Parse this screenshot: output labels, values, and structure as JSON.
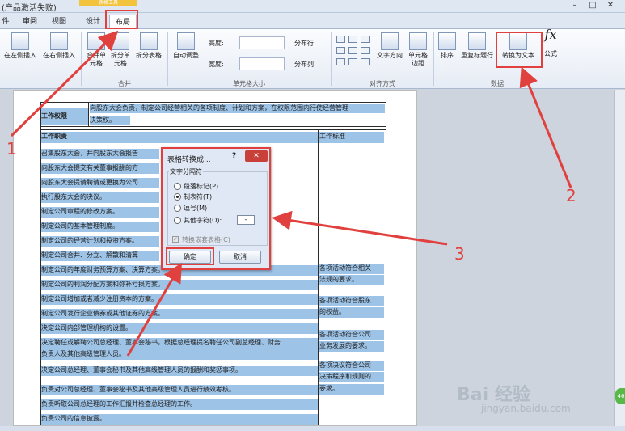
{
  "window": {
    "title": "(产品激活失败)",
    "context_tab_header": "表格工具",
    "min": "–",
    "restore": "□",
    "close": "✕"
  },
  "tabs": [
    {
      "label": "件"
    },
    {
      "label": "审阅"
    },
    {
      "label": "视图"
    },
    {
      "label": "设计"
    },
    {
      "label": "布局",
      "active": true
    }
  ],
  "ribbon": {
    "buttons": {
      "insert_left": "在左侧插入",
      "insert_right": "在右侧插入",
      "merge_cells": "合并单元格",
      "split_cells": "拆分单元格",
      "split_table": "拆分表格",
      "autofit": "自动调整",
      "text_direction": "文字方向",
      "cell_margins": "单元格边距",
      "sort": "排序",
      "repeat_header": "重复标题行",
      "convert_to_text": "转换为文本",
      "formula": "公式"
    },
    "height_label": "高度:",
    "width_label": "宽度:",
    "distribute_rows": "分布行",
    "distribute_cols": "分布列",
    "groups": {
      "merge": "合并",
      "cell_size": "单元格大小",
      "alignment": "对齐方式",
      "data": "数据"
    }
  },
  "table": {
    "header_row": "工作权限",
    "header_text": "向股东大会负责，制定公司经营相关的各项制度、计划和方案，在权限范围内行使经营管理",
    "header_text2": "决策权。",
    "col_duty": "工作职责",
    "col_standard": "工作标准",
    "rows": [
      "召集股东大会，并向股东大会报告",
      "向股东大会提交有关董事报酬的方",
      "向股东大会提请聘请或更换为公司",
      "执行股东大会的决议。",
      "制定公司章程的修改方案。",
      "制定公司的基本管理制度。",
      "制定公司的经营计划和投资方案。",
      "制定公司合并、分立、解散和清算",
      "制定公司的年度财务预算方案、决算方案。",
      "制定公司的利润分配方案和弥补亏损方案。",
      "制定公司增加或者减少注册资本的方案。",
      "制定公司发行企业债券或其他证券的方案。",
      "决定公司内部管理机构的设置。",
      "决定聘任或解聘公司总经理、董事会秘书，根据总经理提名聘任公司副总经理、财务",
      "负责人及其他高级管理人员。",
      "决定公司总经理、董事会秘书及其他高级管理人员的报酬和奖惩事项。",
      "负责对公司总经理、董事会秘书及其他高级管理人员进行绩效考核。",
      "负责听取公司总经理的工作汇报并检查总经理的工作。",
      "负责公司的信息披露。"
    ],
    "standards": [
      "各项活动符合相关",
      "法规的要求。",
      "各项活动符合股东",
      "的权益。",
      "各项活动符合公司",
      "业务发展的要求。",
      "各项决议符合公司",
      "决策程序和规则的",
      "要求。"
    ]
  },
  "dialog": {
    "title": "表格转换成...",
    "help": "?",
    "close": "✕",
    "group_label": "文字分隔符",
    "options": [
      {
        "label": "段落标记(P)",
        "checked": false
      },
      {
        "label": "制表符(T)",
        "checked": true
      },
      {
        "label": "逗号(M)",
        "checked": false
      },
      {
        "label": "其他字符(O):",
        "checked": false
      }
    ],
    "other_char_value": "-",
    "nested_label": "转换嵌套表格(C)",
    "ok": "确定",
    "cancel": "取消"
  },
  "annotations": {
    "num1": "1",
    "num2": "2",
    "num3": "3"
  },
  "watermark": {
    "text": "Bai 经验",
    "sub": "jingyan.baidu.com",
    "badge": "46"
  }
}
